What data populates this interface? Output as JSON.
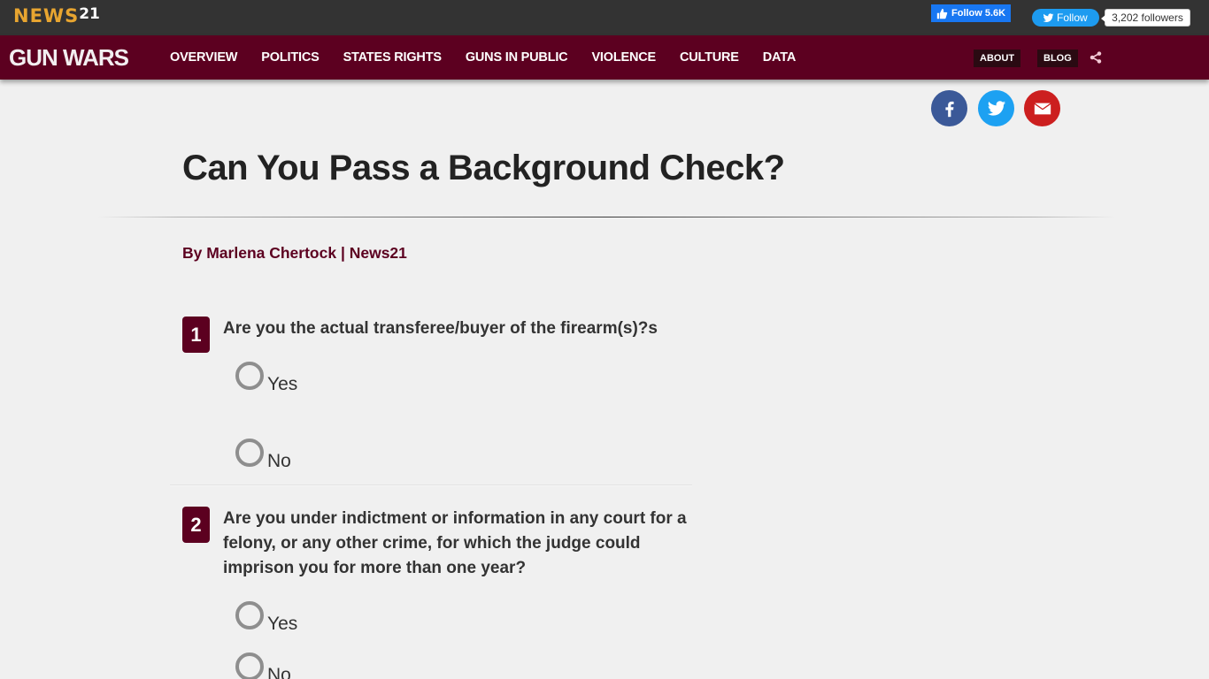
{
  "topbar": {
    "logo_main": "NEWS",
    "logo_sup": "21",
    "facebook_follow": "Follow 5.6K",
    "twitter_follow": "Follow",
    "twitter_followers": "3,202 followers"
  },
  "navbar": {
    "site_title": "GUN WARS",
    "items": [
      {
        "label": "OVERVIEW"
      },
      {
        "label": "POLITICS"
      },
      {
        "label": "STATES RIGHTS"
      },
      {
        "label": "GUNS IN PUBLIC"
      },
      {
        "label": "VIOLENCE"
      },
      {
        "label": "CULTURE"
      },
      {
        "label": "DATA"
      }
    ],
    "about_label": "ABOUT",
    "blog_label": "BLOG",
    "share_icon": "share-icon"
  },
  "social": {
    "icons": [
      "facebook-icon",
      "twitter-icon",
      "email-icon"
    ],
    "colors": {
      "facebook": "#3b5998",
      "twitter": "#1da1f2",
      "email": "#cc1f1f"
    }
  },
  "article": {
    "title": "Can You Pass a Background Check?",
    "byline": "By Marlena Chertock | News21"
  },
  "questions": [
    {
      "number": "1",
      "text": "Are you the actual transferee/buyer of the firearm(s)?s",
      "options": [
        {
          "label": "Yes",
          "selected": false
        },
        {
          "label": "No",
          "selected": false
        }
      ]
    },
    {
      "number": "2",
      "text": "Are you under indictment or information in any court for a felony, or any other crime, for which the judge could imprison you for more than one year?",
      "options": [
        {
          "label": "Yes",
          "selected": false
        },
        {
          "label": "No",
          "selected": false
        }
      ]
    }
  ],
  "colors": {
    "brand": "#5c0020",
    "logo_orange": "#e8a530",
    "topbar": "#333333",
    "background": "#f0f0f0"
  }
}
